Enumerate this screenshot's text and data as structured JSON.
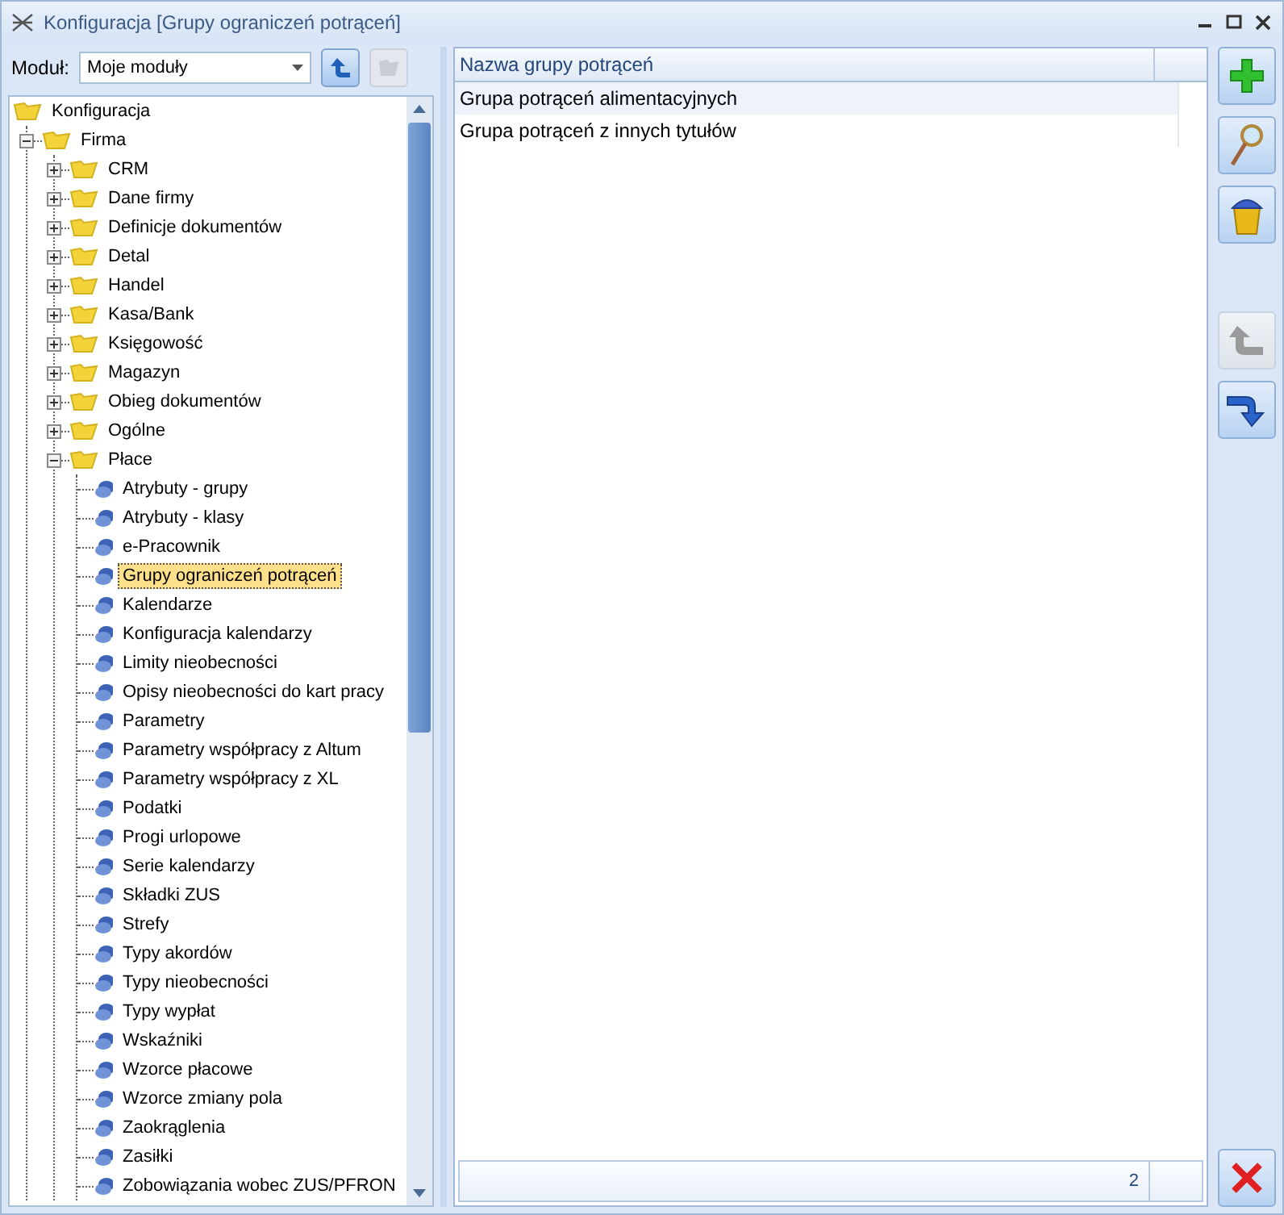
{
  "window": {
    "title": "Konfiguracja [Grupy ograniczeń potrąceń]"
  },
  "module": {
    "label": "Moduł:",
    "value": "Moje moduły"
  },
  "tree": [
    {
      "label": "Konfiguracja",
      "kind": "root",
      "children": [
        {
          "label": "Firma",
          "kind": "folder",
          "expanded": true,
          "children": [
            {
              "label": "CRM",
              "kind": "folder",
              "expanded": false
            },
            {
              "label": "Dane firmy",
              "kind": "folder",
              "expanded": false
            },
            {
              "label": "Definicje dokumentów",
              "kind": "folder",
              "expanded": false
            },
            {
              "label": "Detal",
              "kind": "folder",
              "expanded": false
            },
            {
              "label": "Handel",
              "kind": "folder",
              "expanded": false
            },
            {
              "label": "Kasa/Bank",
              "kind": "folder",
              "expanded": false
            },
            {
              "label": "Księgowość",
              "kind": "folder",
              "expanded": false
            },
            {
              "label": "Magazyn",
              "kind": "folder",
              "expanded": false
            },
            {
              "label": "Obieg dokumentów",
              "kind": "folder",
              "expanded": false
            },
            {
              "label": "Ogólne",
              "kind": "folder",
              "expanded": false
            },
            {
              "label": "Płace",
              "kind": "folder",
              "expanded": true,
              "children": [
                {
                  "label": "Atrybuty - grupy",
                  "kind": "leaf",
                  "selected": false
                },
                {
                  "label": "Atrybuty - klasy",
                  "kind": "leaf",
                  "selected": false
                },
                {
                  "label": "e-Pracownik",
                  "kind": "leaf",
                  "selected": false
                },
                {
                  "label": "Grupy ograniczeń potrąceń",
                  "kind": "leaf",
                  "selected": true
                },
                {
                  "label": "Kalendarze",
                  "kind": "leaf",
                  "selected": false
                },
                {
                  "label": "Konfiguracja kalendarzy",
                  "kind": "leaf",
                  "selected": false
                },
                {
                  "label": "Limity nieobecności",
                  "kind": "leaf",
                  "selected": false
                },
                {
                  "label": "Opisy nieobecności do kart pracy",
                  "kind": "leaf",
                  "selected": false
                },
                {
                  "label": "Parametry",
                  "kind": "leaf",
                  "selected": false
                },
                {
                  "label": "Parametry współpracy z Altum",
                  "kind": "leaf",
                  "selected": false
                },
                {
                  "label": "Parametry współpracy z XL",
                  "kind": "leaf",
                  "selected": false
                },
                {
                  "label": "Podatki",
                  "kind": "leaf",
                  "selected": false
                },
                {
                  "label": "Progi urlopowe",
                  "kind": "leaf",
                  "selected": false
                },
                {
                  "label": "Serie kalendarzy",
                  "kind": "leaf",
                  "selected": false
                },
                {
                  "label": "Składki ZUS",
                  "kind": "leaf",
                  "selected": false
                },
                {
                  "label": "Strefy",
                  "kind": "leaf",
                  "selected": false
                },
                {
                  "label": "Typy akordów",
                  "kind": "leaf",
                  "selected": false
                },
                {
                  "label": "Typy nieobecności",
                  "kind": "leaf",
                  "selected": false
                },
                {
                  "label": "Typy wypłat",
                  "kind": "leaf",
                  "selected": false
                },
                {
                  "label": "Wskaźniki",
                  "kind": "leaf",
                  "selected": false
                },
                {
                  "label": "Wzorce płacowe",
                  "kind": "leaf",
                  "selected": false
                },
                {
                  "label": "Wzorce zmiany pola",
                  "kind": "leaf",
                  "selected": false
                },
                {
                  "label": "Zaokrąglenia",
                  "kind": "leaf",
                  "selected": false
                },
                {
                  "label": "Zasiłki",
                  "kind": "leaf",
                  "selected": false
                },
                {
                  "label": "Zobowiązania wobec ZUS/PFRON",
                  "kind": "leaf",
                  "selected": false
                }
              ]
            }
          ]
        }
      ]
    }
  ],
  "table": {
    "columns": [
      "Nazwa grupy potrąceń"
    ],
    "rows": [
      {
        "cells": [
          "Grupa potrąceń alimentacyjnych"
        ],
        "selected": true
      },
      {
        "cells": [
          "Grupa potrąceń z innych tytułów"
        ],
        "selected": false
      }
    ],
    "footer_count": "2"
  },
  "toolbar": [
    {
      "kind": "add",
      "disabled": false
    },
    {
      "kind": "edit",
      "disabled": false
    },
    {
      "kind": "delete",
      "disabled": false
    },
    {
      "kind": "gap"
    },
    {
      "kind": "undo",
      "disabled": true
    },
    {
      "kind": "redo",
      "disabled": false
    }
  ]
}
